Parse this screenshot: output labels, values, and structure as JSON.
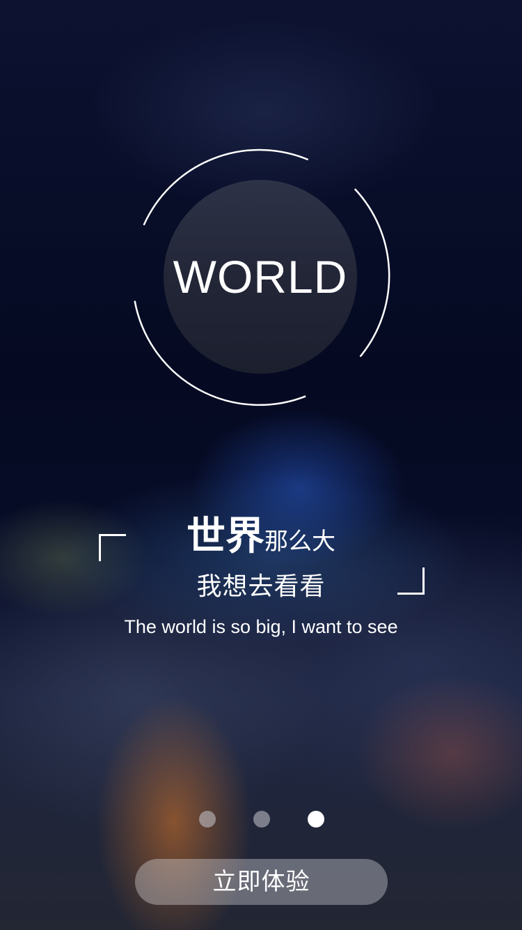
{
  "logo": {
    "text": "WORLD"
  },
  "headline": {
    "emphasis": "世界",
    "rest": "那么大"
  },
  "subline": "我想去看看",
  "english_tagline": "The world is so big, I want to see",
  "pager": {
    "total": 3,
    "active_index": 2
  },
  "cta": {
    "label": "立即体验"
  },
  "colors": {
    "text": "#ffffff",
    "background_dark": "#050a22",
    "disc": "#262a3c",
    "dot_inactive": "rgba(200,200,210,0.55)",
    "dot_active": "#ffffff",
    "button_bg": "rgba(235,235,240,0.35)"
  }
}
